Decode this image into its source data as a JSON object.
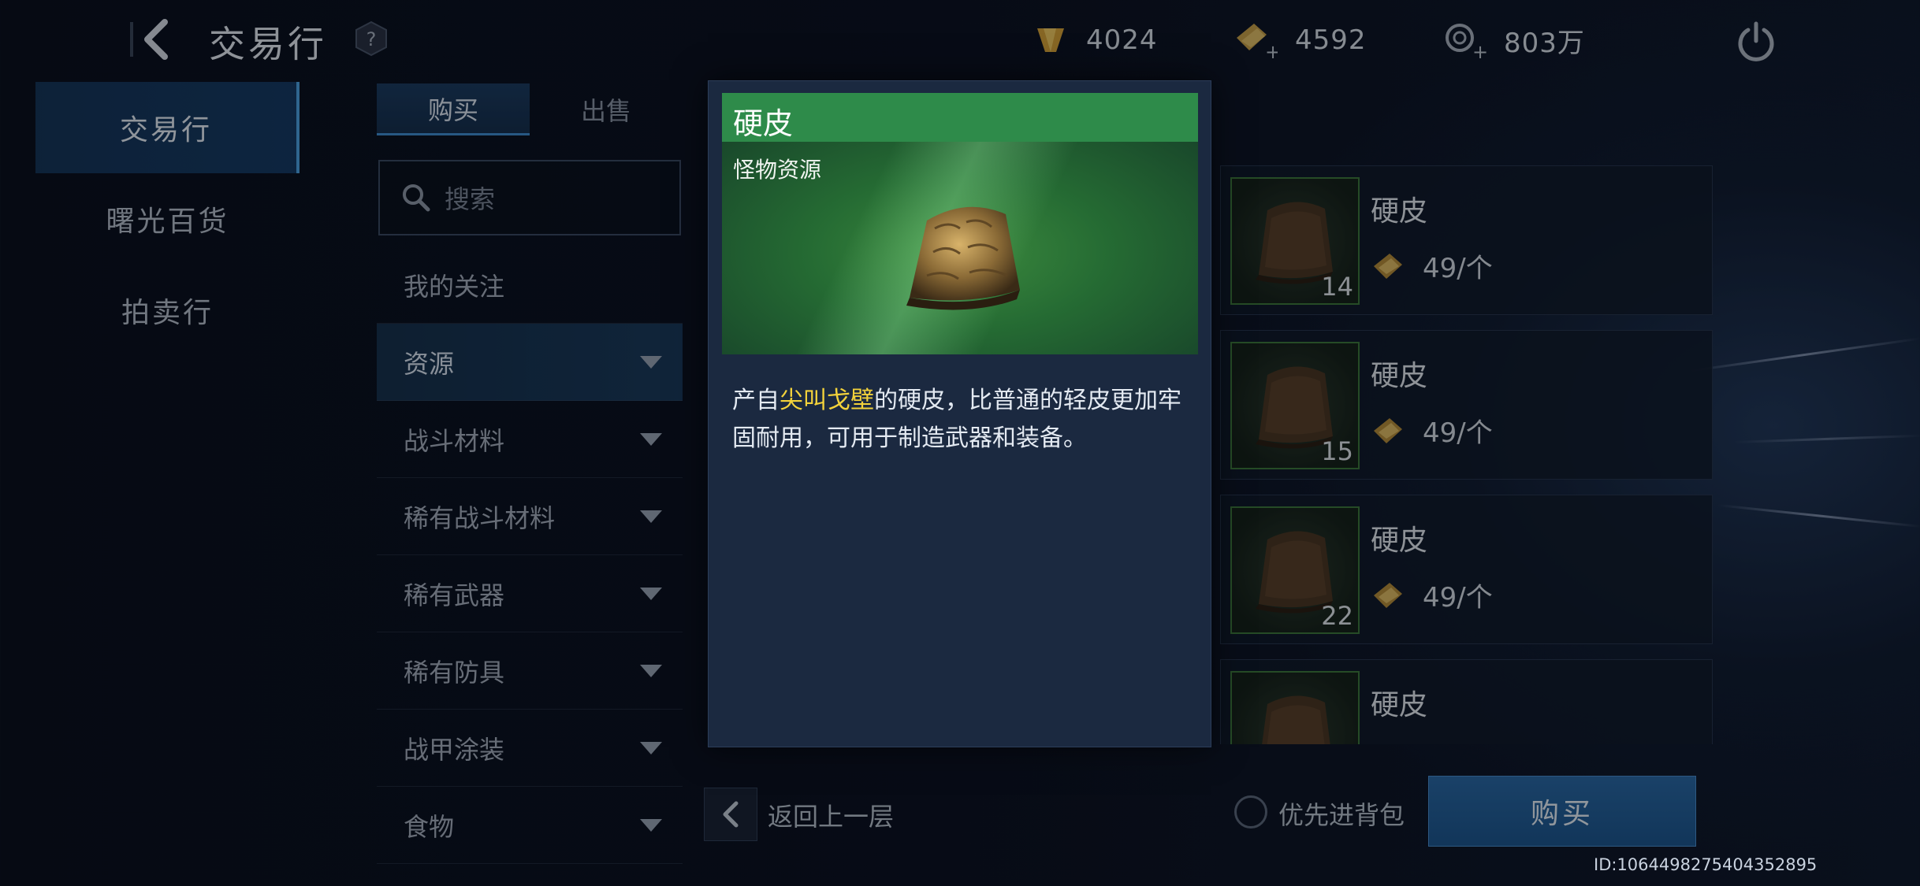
{
  "topbar": {
    "title": "交易行",
    "currencies": [
      {
        "icon": "crystal-currency-icon",
        "value": "4024"
      },
      {
        "icon": "gold-currency-add-icon",
        "value": "4592"
      },
      {
        "icon": "coin-currency-add-icon",
        "value": "803万"
      }
    ]
  },
  "leftnav": {
    "items": [
      {
        "label": "交易行",
        "active": true
      },
      {
        "label": "曙光百货",
        "active": false
      },
      {
        "label": "拍卖行",
        "active": false
      }
    ]
  },
  "tabs": {
    "buy": "购买",
    "sell": "出售"
  },
  "search": {
    "placeholder": "搜索"
  },
  "categories": [
    {
      "label": "我的关注",
      "arrow": false
    },
    {
      "label": "资源",
      "arrow": true
    },
    {
      "label": "战斗材料",
      "arrow": true
    },
    {
      "label": "稀有战斗材料",
      "arrow": true
    },
    {
      "label": "稀有武器",
      "arrow": true
    },
    {
      "label": "稀有防具",
      "arrow": true
    },
    {
      "label": "战甲涂装",
      "arrow": true
    },
    {
      "label": "食物",
      "arrow": true
    }
  ],
  "items": [
    {
      "name": "硬皮",
      "qty": "14",
      "price": "49/个"
    },
    {
      "name": "硬皮",
      "qty": "15",
      "price": "49/个"
    },
    {
      "name": "硬皮",
      "qty": "22",
      "price": "49/个"
    },
    {
      "name": "硬皮",
      "qty": "",
      "price": ""
    }
  ],
  "modal": {
    "title": "硬皮",
    "subtitle": "怪物资源",
    "desc_before": "产自",
    "desc_highlight": "尖叫戈壁",
    "desc_after": "的硬皮，比普通的轻皮更加牢固耐用，可用于制造武器和装备。",
    "highlight_color": "#f3d23b",
    "header_color": "#2e8b4a"
  },
  "bottom": {
    "back_label": "返回上一层",
    "priority_label": "优先进背包",
    "buy_label": "购买"
  },
  "uid": "ID:1064498275404352895"
}
